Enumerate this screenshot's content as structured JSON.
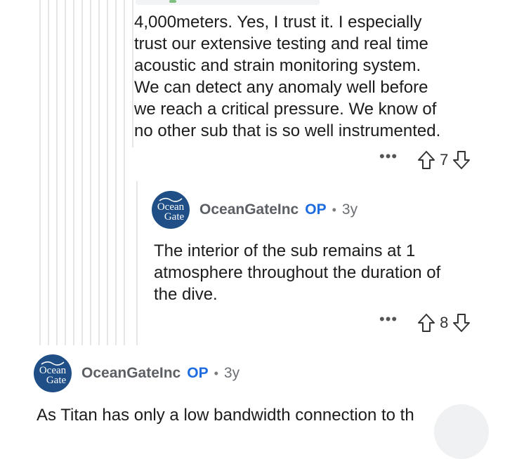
{
  "comments": [
    {
      "body_lines": [
        "4,000meters.  Yes, I trust it.  I especially",
        "trust our extensive testing and real time",
        "acoustic and strain monitoring system.",
        "We can detect any anomaly well before",
        "we reach a critical pressure.  We know of",
        "no other sub that is so well instrumented."
      ],
      "more_label": "•••",
      "vote_count": "7"
    },
    {
      "avatar_text": [
        "Ocean",
        "Gate"
      ],
      "username": "OceanGateInc",
      "op_label": "OP",
      "separator": "•",
      "age": "3y",
      "body_lines": [
        "The interior of the sub remains at 1",
        "atmosphere throughout the duration of",
        "the dive."
      ],
      "more_label": "•••",
      "vote_count": "8"
    },
    {
      "avatar_text": [
        "Ocean",
        "Gate"
      ],
      "username": "OceanGateInc",
      "op_label": "OP",
      "separator": "•",
      "age": "3y",
      "body_lines": [
        "As Titan has only a low bandwidth connection to th"
      ]
    }
  ],
  "icons": {
    "upvote": "upvote-arrow-icon",
    "downvote": "downvote-arrow-icon",
    "more": "more-options-icon"
  },
  "colors": {
    "op_badge": "#1f6ce0",
    "avatar_bg": "#1f4f86",
    "thread_line": "#e4e6e8"
  }
}
